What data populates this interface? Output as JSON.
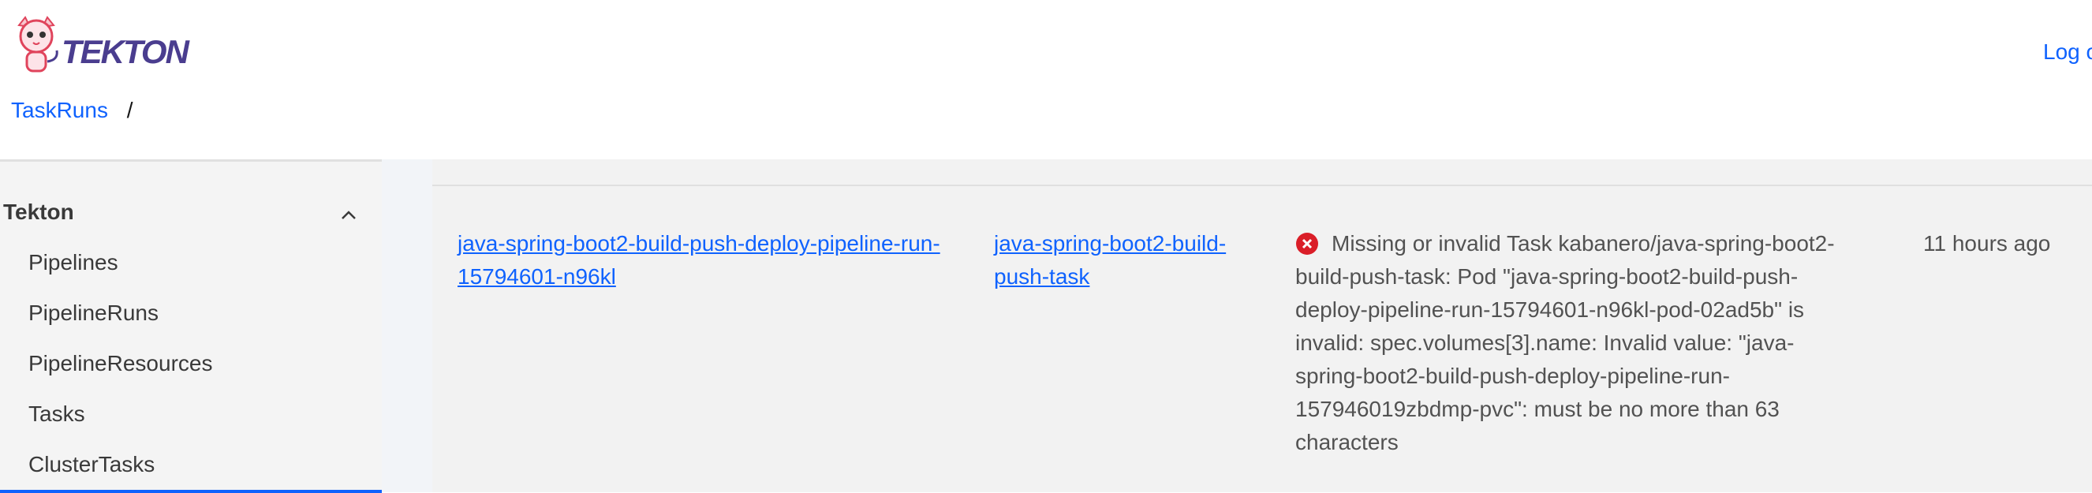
{
  "header": {
    "brand": "TEKTON",
    "logout_label": "Log o"
  },
  "breadcrumb": {
    "link": "TaskRuns",
    "separator": "/"
  },
  "sidebar": {
    "section_title": "Tekton",
    "items": [
      {
        "label": "Pipelines"
      },
      {
        "label": "PipelineRuns"
      },
      {
        "label": "PipelineResources"
      },
      {
        "label": "Tasks"
      },
      {
        "label": "ClusterTasks"
      }
    ]
  },
  "table": {
    "rows": [
      {
        "name": "java-spring-boot2-build-push-deploy-pipeline-run-15794601-n96kl",
        "task": "java-spring-boot2-build-push-task",
        "status": "error",
        "message": "Missing or invalid Task kabanero/java-spring-boot2-build-push-task: Pod \"java-spring-boot2-build-push-deploy-pipeline-run-15794601-n96kl-pod-02ad5b\" is invalid: spec.volumes[3].name: Invalid value: \"java-spring-boot2-build-push-deploy-pipeline-run-157946019zbdmp-pvc\": must be no more than 63 characters",
        "time": "11 hours ago"
      }
    ]
  },
  "colors": {
    "link": "#0f62fe",
    "error": "#da1e28",
    "sidebar_bg": "#f4f4f4",
    "table_bg": "#f2f2f2"
  },
  "icons": {
    "logo": "tekton-cat-logo",
    "collapse": "chevron-up-icon",
    "status": "error-circle-icon"
  }
}
